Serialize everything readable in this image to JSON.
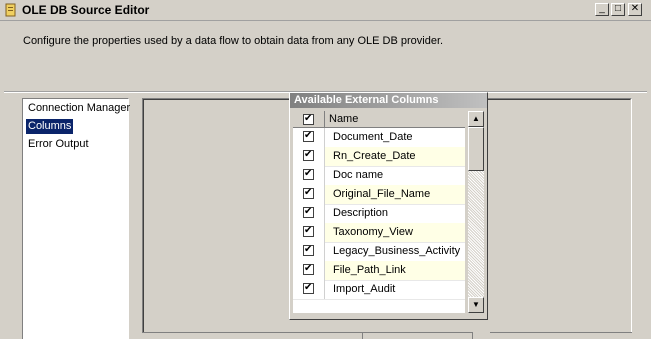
{
  "window": {
    "title": "OLE DB Source Editor",
    "minimize_glyph": "_",
    "maximize_glyph": "□",
    "close_glyph": "✕"
  },
  "description": "Configure the properties used by a data flow to obtain data from any OLE DB provider.",
  "nav": {
    "items": [
      {
        "label": "Connection Manager",
        "selected": false
      },
      {
        "label": "Columns",
        "selected": true
      },
      {
        "label": "Error Output",
        "selected": false
      }
    ]
  },
  "columns_box": {
    "title": "Available External Columns",
    "header": {
      "name_label": "Name",
      "all_checked": true
    },
    "rows": [
      {
        "name": "Document_Date",
        "checked": true
      },
      {
        "name": "Rn_Create_Date",
        "checked": true
      },
      {
        "name": "Doc name",
        "checked": true
      },
      {
        "name": "Original_File_Name",
        "checked": true
      },
      {
        "name": "Description",
        "checked": true
      },
      {
        "name": "Taxonomy_View",
        "checked": true
      },
      {
        "name": "Legacy_Business_Activity",
        "checked": true
      },
      {
        "name": "File_Path_Link",
        "checked": true
      },
      {
        "name": "Import_Audit",
        "checked": true
      }
    ]
  },
  "scrollbar": {
    "up_glyph": "▲",
    "down_glyph": "▼"
  },
  "colors": {
    "selection": "#0a246a",
    "alt_row": "#ffffe6",
    "face": "#d4d0c8"
  }
}
